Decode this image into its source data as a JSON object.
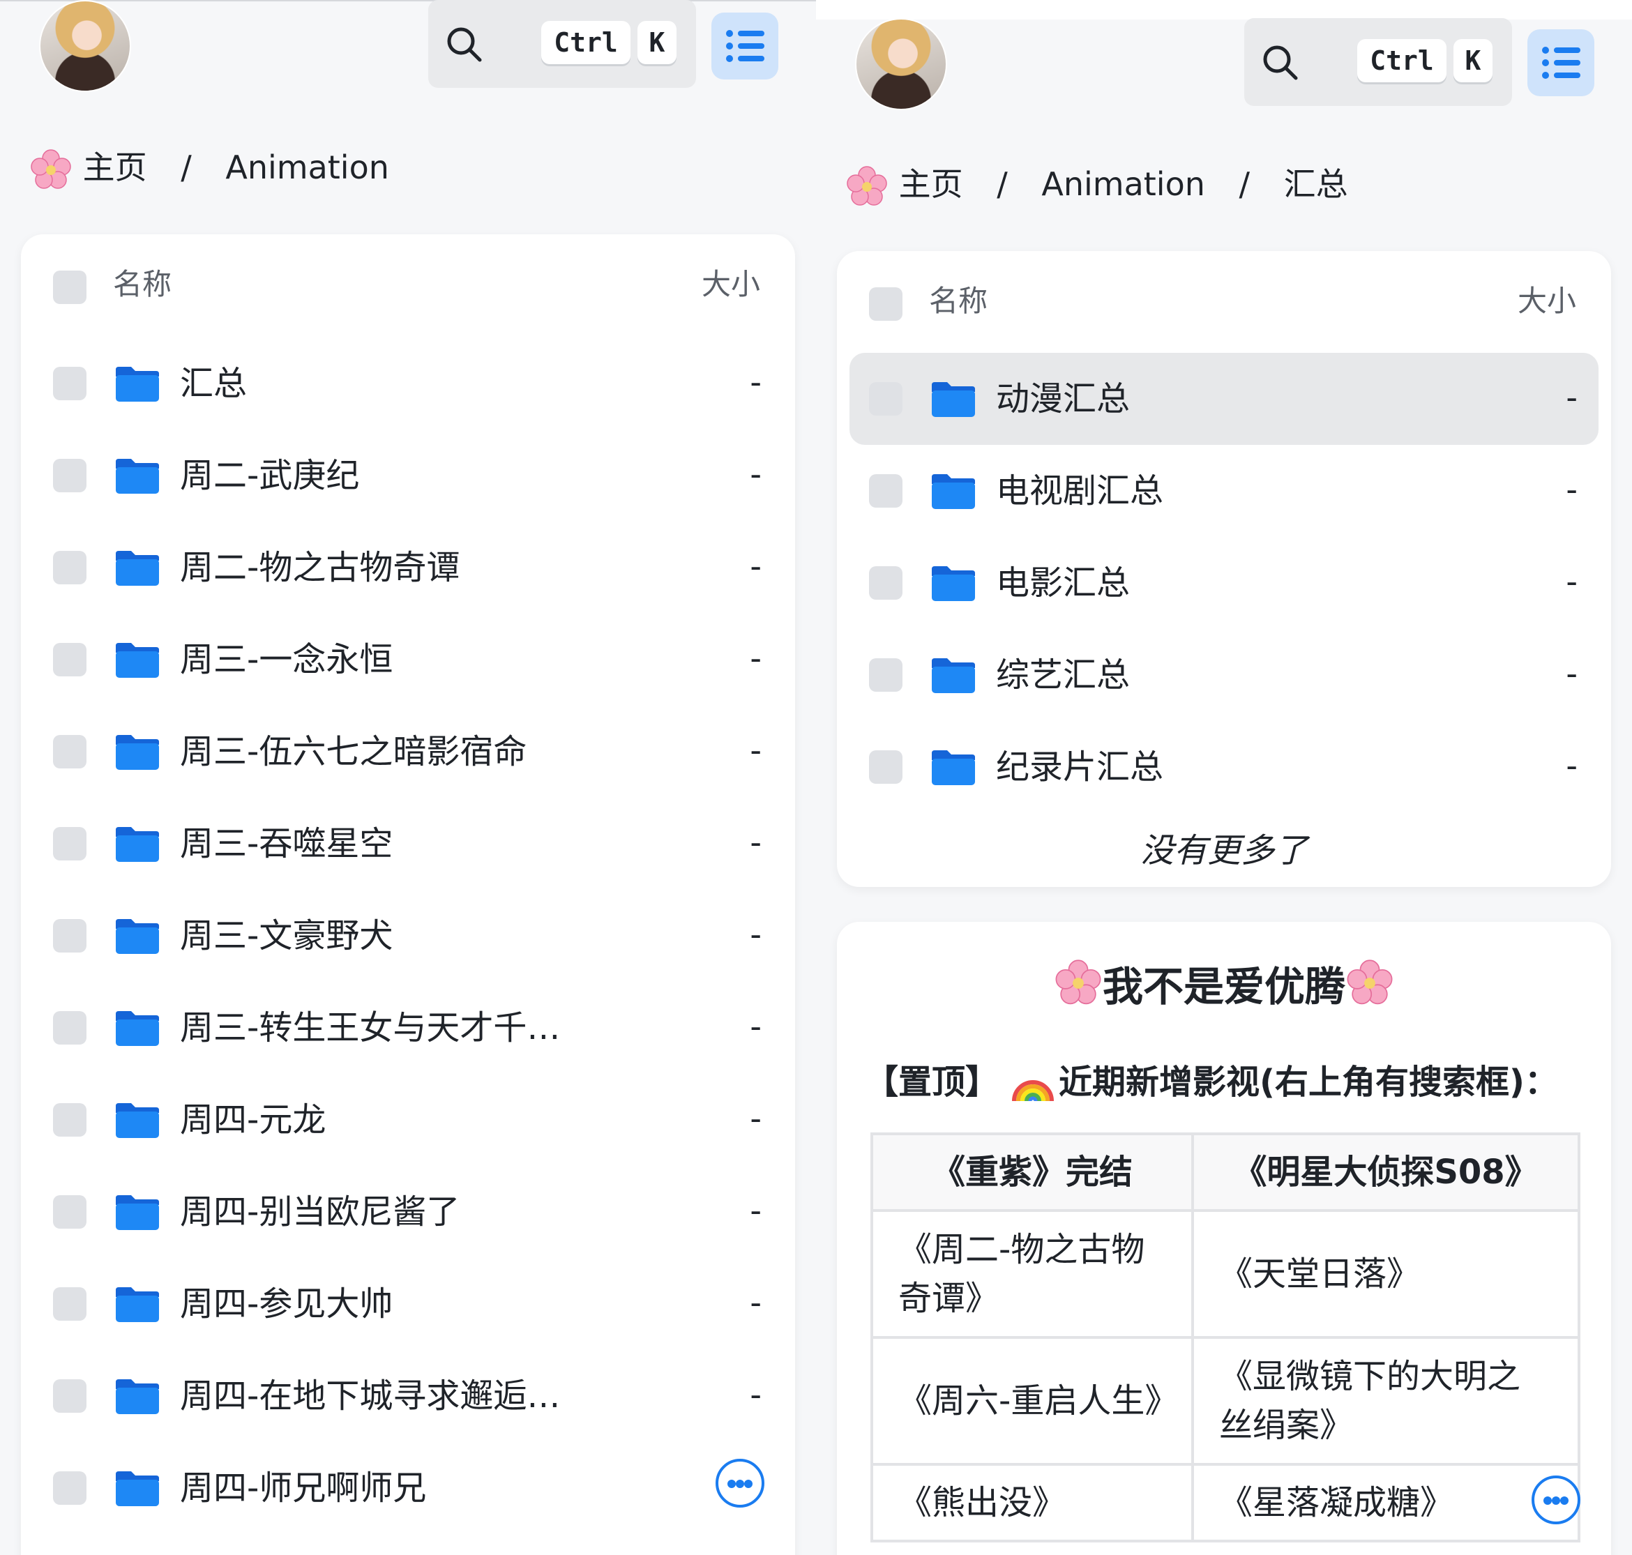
{
  "header": {
    "kbd_ctrl": "Ctrl",
    "kbd_k": "K"
  },
  "left": {
    "breadcrumb": {
      "home": "主页",
      "sep": "/",
      "items": [
        "Animation"
      ]
    },
    "list": {
      "header_name": "名称",
      "header_size": "大小",
      "rows": [
        {
          "name": "汇总",
          "size": "-"
        },
        {
          "name": "周二-武庚纪",
          "size": "-"
        },
        {
          "name": "周二-物之古物奇谭",
          "size": "-"
        },
        {
          "name": "周三-一念永恒",
          "size": "-"
        },
        {
          "name": "周三-伍六七之暗影宿命",
          "size": "-"
        },
        {
          "name": "周三-吞噬星空",
          "size": "-"
        },
        {
          "name": "周三-文豪野犬",
          "size": "-"
        },
        {
          "name": "周三-转生王女与天才千…",
          "size": "-"
        },
        {
          "name": "周四-元龙",
          "size": "-"
        },
        {
          "name": "周四-别当欧尼酱了",
          "size": "-"
        },
        {
          "name": "周四-参见大帅",
          "size": "-"
        },
        {
          "name": "周四-在地下城寻求邂逅…",
          "size": "-"
        },
        {
          "name": "周四-师兄啊师兄",
          "size": ""
        }
      ]
    }
  },
  "right": {
    "breadcrumb": {
      "home": "主页",
      "sep": "/",
      "items": [
        "Animation",
        "汇总"
      ]
    },
    "list": {
      "header_name": "名称",
      "header_size": "大小",
      "rows": [
        {
          "name": "动漫汇总",
          "size": "-"
        },
        {
          "name": "电视剧汇总",
          "size": "-"
        },
        {
          "name": "电影汇总",
          "size": "-"
        },
        {
          "name": "综艺汇总",
          "size": "-"
        },
        {
          "name": "纪录片汇总",
          "size": "-"
        }
      ],
      "end_text": "没有更多了"
    },
    "notice": {
      "title": "我不是爱优腾",
      "line_prefix": "【置顶】",
      "line_text": "近期新增影视(右上角有搜索框)：",
      "table": {
        "head": [
          "《重紫》完结",
          "《明星大侦探S08》"
        ],
        "rows": [
          [
            "《周二-物之古物奇谭》",
            "《天堂日落》"
          ],
          [
            "《周六-重启人生》",
            "《显微镜下的大明之丝绢案》"
          ],
          [
            "《熊出没》",
            "《星落凝成糖》"
          ]
        ]
      }
    }
  },
  "colors": {
    "accent": "#1a7cf0",
    "folder": "#1e88f5",
    "background": "#f6f7f9",
    "card": "#ffffff",
    "highlight_row": "#e7e8ea"
  },
  "icons": [
    "avatar",
    "search-icon",
    "menu-list-icon",
    "flower-icon",
    "folder-icon",
    "more-options-icon",
    "rainbow-icon",
    "checkbox"
  ]
}
